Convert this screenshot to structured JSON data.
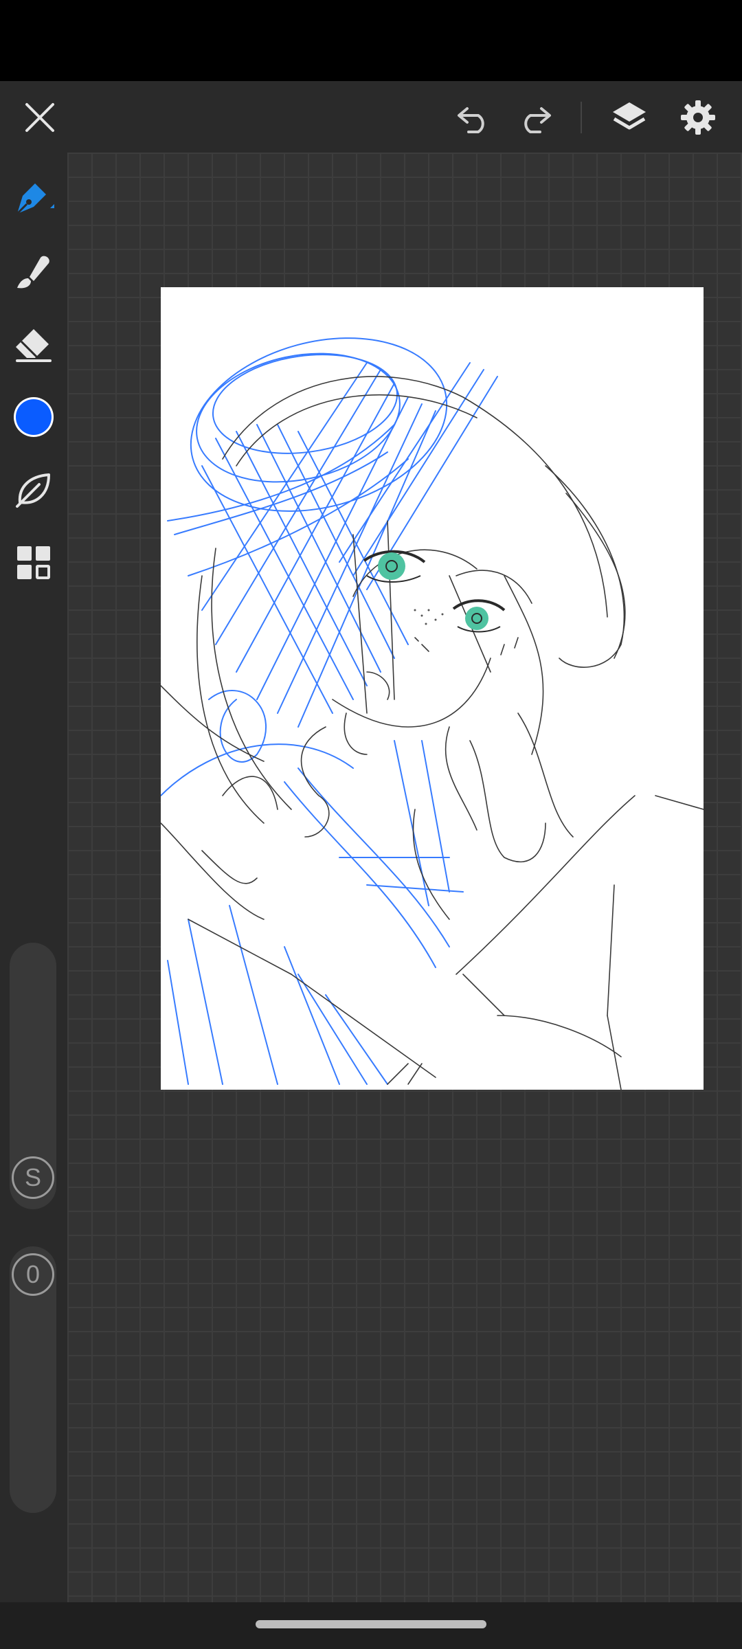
{
  "toolbar": {
    "close_icon": "close-icon",
    "undo_icon": "undo-icon",
    "redo_icon": "redo-icon",
    "layers_icon": "layers-icon",
    "settings_icon": "gear-icon"
  },
  "tools": {
    "items": [
      {
        "name": "pen",
        "icon": "pen-icon",
        "active": true
      },
      {
        "name": "smudge",
        "icon": "smudge-icon",
        "active": false
      },
      {
        "name": "eraser",
        "icon": "eraser-icon",
        "active": false
      },
      {
        "name": "color",
        "icon": "color-swatch",
        "active": false
      },
      {
        "name": "brush",
        "icon": "leaf-icon",
        "active": false
      },
      {
        "name": "materials",
        "icon": "grid-icon",
        "active": false
      }
    ]
  },
  "colors": {
    "current": "#0a5cff",
    "accent": "#1e88e5",
    "stroke_dark": "#3a3a3a",
    "stroke_blue": "#1565ff",
    "eye_green": "#4fc3a1"
  },
  "sliders": {
    "size_label": "S",
    "opacity_label": "0"
  }
}
